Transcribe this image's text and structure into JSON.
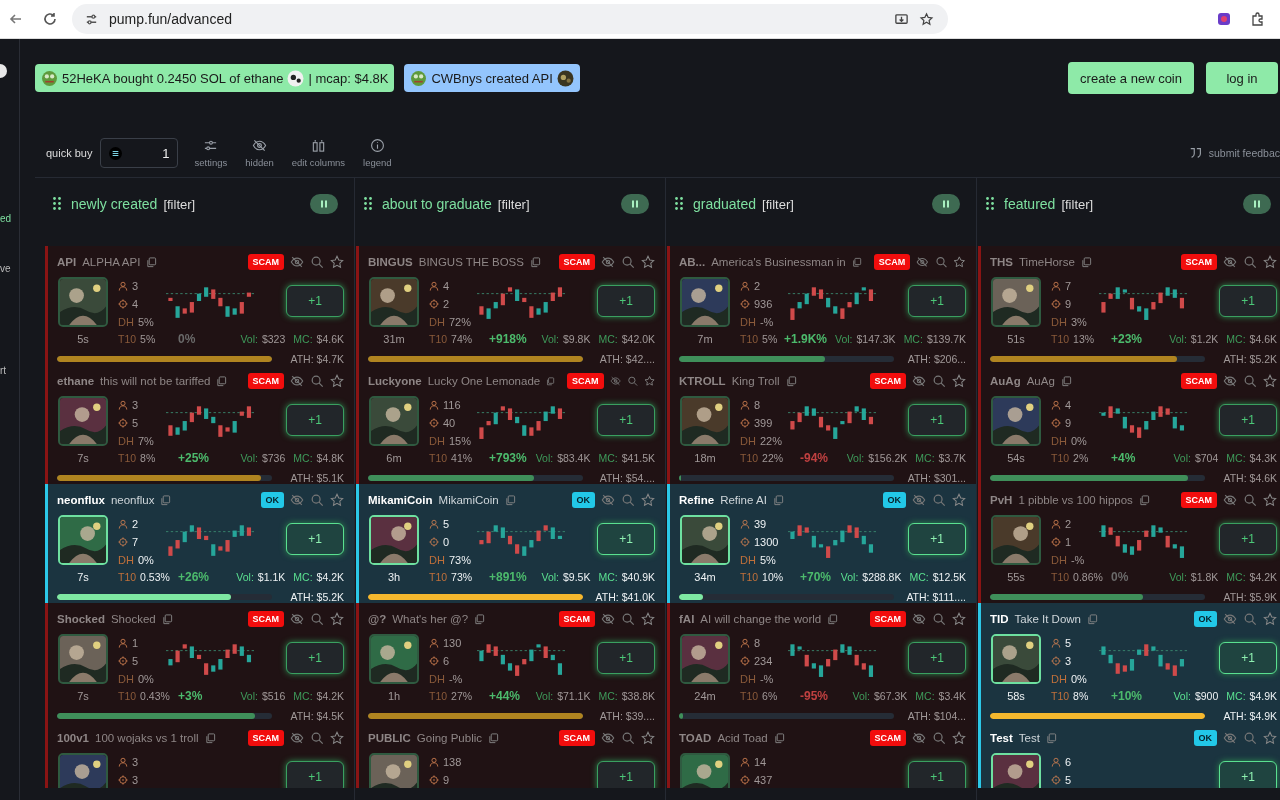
{
  "browser": {
    "url": "pump.fun/advanced"
  },
  "sidebar": {
    "fragments": [
      {
        "text": "ed",
        "selected": true
      },
      {
        "text": "ve",
        "selected": false
      },
      {
        "text": "rt",
        "selected": false
      }
    ]
  },
  "ticker": [
    {
      "kind": "buy",
      "text": "52HeKA bought 0.2450 SOL of ethane",
      "suffix": "| mcap: $4.8K"
    },
    {
      "kind": "create",
      "text": "CWBnys created API"
    }
  ],
  "actions": [
    "create a new coin",
    "log in"
  ],
  "toolbar": {
    "quick_buy_label": "quick buy",
    "quick_buy_value": "1",
    "tools": [
      {
        "kind": "settings",
        "label": "settings"
      },
      {
        "kind": "hidden",
        "label": "hidden"
      },
      {
        "kind": "columns",
        "label": "edit columns"
      },
      {
        "kind": "legend",
        "label": "legend"
      }
    ],
    "feedback": "submit feedbac"
  },
  "columns": [
    {
      "title": "newly created",
      "filter": "[filter]",
      "cards": [
        {
          "kind": "scam",
          "ticker": "API",
          "name": "ALPHA API",
          "badge": "SCAM",
          "holders": "3",
          "snipers": "4",
          "dh": {
            "label": "DH",
            "value": "5%"
          },
          "t10": {
            "label": "T10",
            "value": "5%"
          },
          "change": {
            "text": "0%",
            "color": "#6a6a6a"
          },
          "vol": {
            "label": "Vol:",
            "value": "$323"
          },
          "mc": {
            "label": "MC:",
            "value": "$4.6K"
          },
          "progress": {
            "level": 1,
            "color": "#b08420"
          },
          "ath": {
            "label": "ATH:",
            "value": "$4.7K"
          },
          "age": "5s",
          "buy": "+1"
        },
        {
          "kind": "scam",
          "ticker": "ethane",
          "name": "this will not be tariffed",
          "badge": "SCAM",
          "holders": "3",
          "snipers": "5",
          "dh": {
            "label": "DH",
            "value": "7%"
          },
          "t10": {
            "label": "T10",
            "value": "8%"
          },
          "change": {
            "text": "+25%",
            "color": "#4cba6c"
          },
          "vol": {
            "label": "Vol:",
            "value": "$736"
          },
          "mc": {
            "label": "MC:",
            "value": "$4.8K"
          },
          "progress": {
            "level": 0.95,
            "color": "#b08420"
          },
          "ath": {
            "label": "ATH:",
            "value": "$5.1K"
          },
          "age": "7s",
          "buy": "+1"
        },
        {
          "kind": "ok",
          "ticker": "neonflux",
          "name": "neonflux",
          "badge": "OK",
          "holders": "2",
          "snipers": "7",
          "dh": {
            "label": "DH",
            "value": "0%"
          },
          "t10": {
            "label": "T10",
            "value": "0.53%"
          },
          "change": {
            "text": "+26%",
            "color": "#4cba6c"
          },
          "vol": {
            "label": "Vol:",
            "value": "$1.1K"
          },
          "mc": {
            "label": "MC:",
            "value": "$4.2K"
          },
          "progress": {
            "level": 0.81,
            "color": "#7ee8a2"
          },
          "ath": {
            "label": "ATH:",
            "value": "$5.2K"
          },
          "age": "7s",
          "buy": "+1"
        },
        {
          "kind": "scam",
          "ticker": "Shocked",
          "name": "Shocked",
          "badge": "SCAM",
          "holders": "1",
          "snipers": "5",
          "dh": {
            "label": "DH",
            "value": "0%"
          },
          "t10": {
            "label": "T10",
            "value": "0.43%"
          },
          "change": {
            "text": "+3%",
            "color": "#4cba6c"
          },
          "vol": {
            "label": "Vol:",
            "value": "$516"
          },
          "mc": {
            "label": "MC:",
            "value": "$4.2K"
          },
          "progress": {
            "level": 0.92,
            "color": "#3f8f5a"
          },
          "ath": {
            "label": "ATH:",
            "value": "$4.5K"
          },
          "age": "7s",
          "buy": "+1"
        },
        {
          "kind": "scam",
          "ticker": "100v1",
          "name": "100 wojaks vs 1 troll",
          "badge": "SCAM",
          "holders": "3",
          "snipers": "3",
          "buy": "+1"
        }
      ]
    },
    {
      "title": "about to graduate",
      "filter": "[filter]",
      "cards": [
        {
          "kind": "scam",
          "ticker": "BINGUS",
          "name": "BINGUS THE BOSS",
          "badge": "SCAM",
          "holders": "4",
          "snipers": "2",
          "dh": {
            "label": "DH",
            "value": "72%"
          },
          "t10": {
            "label": "T10",
            "value": "74%"
          },
          "change": {
            "text": "+918%",
            "color": "#4cba6c"
          },
          "vol": {
            "label": "Vol:",
            "value": "$9.8K"
          },
          "mc": {
            "label": "MC:",
            "value": "$42.0K"
          },
          "progress": {
            "level": 1,
            "color": "#b08420"
          },
          "ath": {
            "label": "ATH:",
            "value": "$42...."
          },
          "age": "31m",
          "buy": "+1"
        },
        {
          "kind": "scam",
          "ticker": "Luckyone",
          "name": "Lucky One Lemonade",
          "badge": "SCAM",
          "holders": "116",
          "snipers": "40",
          "dh": {
            "label": "DH",
            "value": "15%"
          },
          "t10": {
            "label": "T10",
            "value": "41%"
          },
          "change": {
            "text": "+793%",
            "color": "#4cba6c"
          },
          "vol": {
            "label": "Vol:",
            "value": "$83.4K"
          },
          "mc": {
            "label": "MC:",
            "value": "$41.5K"
          },
          "progress": {
            "level": 0.77,
            "color": "#3f8f5a"
          },
          "ath": {
            "label": "ATH:",
            "value": "$54...."
          },
          "age": "6m",
          "buy": "+1"
        },
        {
          "kind": "ok",
          "ticker": "MikamiCoin",
          "name": "MikamiCoin",
          "badge": "OK",
          "holders": "5",
          "snipers": "0",
          "dh": {
            "label": "DH",
            "value": "73%"
          },
          "t10": {
            "label": "T10",
            "value": "73%"
          },
          "change": {
            "text": "+891%",
            "color": "#4cba6c"
          },
          "vol": {
            "label": "Vol:",
            "value": "$9.5K"
          },
          "mc": {
            "label": "MC:",
            "value": "$40.9K"
          },
          "progress": {
            "level": 1,
            "color": "#f5b82e"
          },
          "ath": {
            "label": "ATH:",
            "value": "$41.0K"
          },
          "age": "3h",
          "buy": "+1"
        },
        {
          "kind": "scam",
          "ticker": "@?",
          "name": "What's her @?",
          "badge": "SCAM",
          "holders": "130",
          "snipers": "6",
          "dh": {
            "label": "DH",
            "value": "-%"
          },
          "t10": {
            "label": "T10",
            "value": "27%"
          },
          "change": {
            "text": "+44%",
            "color": "#4cba6c"
          },
          "vol": {
            "label": "Vol:",
            "value": "$71.1K"
          },
          "mc": {
            "label": "MC:",
            "value": "$38.8K"
          },
          "progress": {
            "level": 1,
            "color": "#b08420"
          },
          "ath": {
            "label": "ATH:",
            "value": "$39...."
          },
          "age": "1h",
          "buy": "+1"
        },
        {
          "kind": "scam",
          "ticker": "PUBLIC",
          "name": "Going Public",
          "badge": "SCAM",
          "holders": "138",
          "snipers": "9",
          "buy": "+1"
        }
      ]
    },
    {
      "title": "graduated",
      "filter": "[filter]",
      "cards": [
        {
          "kind": "scam",
          "ticker": "AB...",
          "name": "America's Businessman in",
          "badge": "SCAM",
          "holders": "2",
          "snipers": "936",
          "dh": {
            "label": "DH",
            "value": "-%"
          },
          "t10": {
            "label": "T10",
            "value": "5%"
          },
          "change": {
            "text": "+1.9K%",
            "color": "#4cba6c"
          },
          "vol": {
            "label": "Vol:",
            "value": "$147.3K"
          },
          "mc": {
            "label": "MC:",
            "value": "$139.7K"
          },
          "progress": {
            "level": 0.68,
            "color": "#3f8f5a"
          },
          "ath": {
            "label": "ATH:",
            "value": "$206..."
          },
          "age": "7m",
          "buy": "+1"
        },
        {
          "kind": "scam",
          "ticker": "KTROLL",
          "name": "King Troll",
          "badge": "SCAM",
          "holders": "8",
          "snipers": "399",
          "dh": {
            "label": "DH",
            "value": "22%"
          },
          "t10": {
            "label": "T10",
            "value": "22%"
          },
          "change": {
            "text": "-94%",
            "color": "#c04040"
          },
          "vol": {
            "label": "Vol:",
            "value": "$156.2K"
          },
          "mc": {
            "label": "MC:",
            "value": "$3.7K"
          },
          "progress": {
            "level": 0.01,
            "color": "#3f8f5a"
          },
          "ath": {
            "label": "ATH:",
            "value": "$301..."
          },
          "age": "18m",
          "buy": "+1"
        },
        {
          "kind": "ok",
          "ticker": "Refine",
          "name": "Refine AI",
          "badge": "OK",
          "holders": "39",
          "snipers": "1300",
          "dh": {
            "label": "DH",
            "value": "5%"
          },
          "t10": {
            "label": "T10",
            "value": "10%"
          },
          "change": {
            "text": "+70%",
            "color": "#4cba6c"
          },
          "vol": {
            "label": "Vol:",
            "value": "$288.8K"
          },
          "mc": {
            "label": "MC:",
            "value": "$12.5K"
          },
          "progress": {
            "level": 0.11,
            "color": "#7ee8a2"
          },
          "ath": {
            "label": "ATH:",
            "value": "$111...."
          },
          "age": "34m",
          "buy": "+1"
        },
        {
          "kind": "scam",
          "ticker": "fAI",
          "name": "AI will change the world",
          "badge": "SCAM",
          "holders": "8",
          "snipers": "234",
          "dh": {
            "label": "DH",
            "value": "-%"
          },
          "t10": {
            "label": "T10",
            "value": "6%"
          },
          "change": {
            "text": "-95%",
            "color": "#c04040"
          },
          "vol": {
            "label": "Vol:",
            "value": "$67.3K"
          },
          "mc": {
            "label": "MC:",
            "value": "$3.4K"
          },
          "progress": {
            "level": 0.02,
            "color": "#3f8f5a"
          },
          "ath": {
            "label": "ATH:",
            "value": "$104..."
          },
          "age": "24m",
          "buy": "+1"
        },
        {
          "kind": "scam",
          "ticker": "TOAD",
          "name": "Acid Toad",
          "badge": "SCAM",
          "holders": "14",
          "snipers": "437",
          "buy": "+1"
        }
      ]
    },
    {
      "title": "featured",
      "filter": "[filter]",
      "cards": [
        {
          "kind": "scam",
          "ticker": "THS",
          "name": "TimeHorse",
          "badge": "SCAM",
          "holders": "7",
          "snipers": "9",
          "dh": {
            "label": "DH",
            "value": "3%"
          },
          "t10": {
            "label": "T10",
            "value": "13%"
          },
          "change": {
            "text": "+23%",
            "color": "#4cba6c"
          },
          "vol": {
            "label": "Vol:",
            "value": "$1.2K"
          },
          "mc": {
            "label": "MC:",
            "value": "$4.6K"
          },
          "progress": {
            "level": 0.87,
            "color": "#b08420"
          },
          "ath": {
            "label": "ATH:",
            "value": "$5.2K"
          },
          "age": "51s",
          "buy": "+1"
        },
        {
          "kind": "scam",
          "ticker": "AuAg",
          "name": "AuAg",
          "badge": "SCAM",
          "holders": "4",
          "snipers": "9",
          "dh": {
            "label": "DH",
            "value": "0%"
          },
          "t10": {
            "label": "T10",
            "value": "2%"
          },
          "change": {
            "text": "+4%",
            "color": "#4cba6c"
          },
          "vol": {
            "label": "Vol:",
            "value": "$704"
          },
          "mc": {
            "label": "MC:",
            "value": "$4.3K"
          },
          "progress": {
            "level": 0.92,
            "color": "#3f8f5a"
          },
          "ath": {
            "label": "ATH:",
            "value": "$4.6K"
          },
          "age": "54s",
          "buy": "+1"
        },
        {
          "kind": "scam",
          "ticker": "PvH",
          "name": "1 pibble vs 100 hippos",
          "badge": "SCAM",
          "holders": "2",
          "snipers": "1",
          "dh": {
            "label": "DH",
            "value": "-%"
          },
          "t10": {
            "label": "T10",
            "value": "0.86%"
          },
          "change": {
            "text": "0%",
            "color": "#6a6a6a"
          },
          "vol": {
            "label": "Vol:",
            "value": "$1.8K"
          },
          "mc": {
            "label": "MC:",
            "value": "$4.2K"
          },
          "progress": {
            "level": 0.71,
            "color": "#3f8f5a"
          },
          "ath": {
            "label": "ATH:",
            "value": "$5.9K"
          },
          "age": "55s",
          "buy": "+1"
        },
        {
          "kind": "ok",
          "ticker": "TID",
          "name": "Take It Down",
          "badge": "OK",
          "holders": "5",
          "snipers": "3",
          "dh": {
            "label": "DH",
            "value": "0%"
          },
          "t10": {
            "label": "T10",
            "value": "8%"
          },
          "change": {
            "text": "+10%",
            "color": "#4cba6c"
          },
          "vol": {
            "label": "Vol:",
            "value": "$900"
          },
          "mc": {
            "label": "MC:",
            "value": "$4.9K"
          },
          "progress": {
            "level": 1,
            "color": "#f5b82e"
          },
          "ath": {
            "label": "ATH:",
            "value": "$4.9K"
          },
          "age": "58s",
          "buy": "+1"
        },
        {
          "kind": "ok",
          "ticker": "Test",
          "name": "Test",
          "badge": "OK",
          "holders": "6",
          "snipers": "5",
          "buy": "+1"
        }
      ]
    }
  ]
}
